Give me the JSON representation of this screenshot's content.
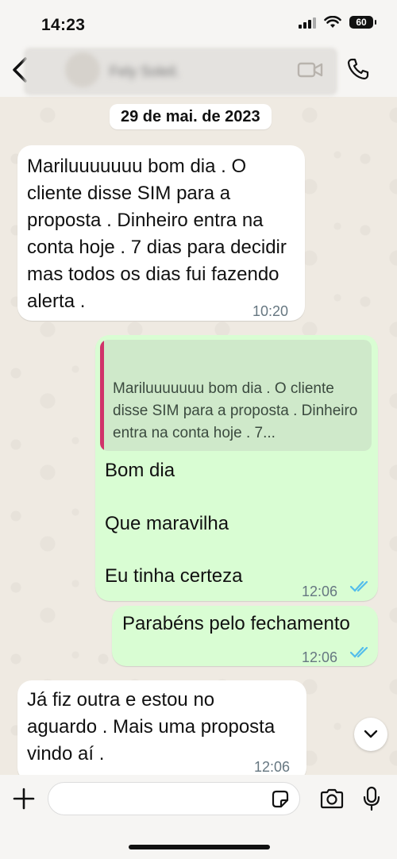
{
  "status_bar": {
    "time": "14:23",
    "battery": "60"
  },
  "header": {
    "contact_name": "Fely Soleil."
  },
  "date_chip": "29 de mai. de 2023",
  "messages": [
    {
      "dir": "in",
      "text": "Mariluuuuuuu bom dia . O cliente disse SIM para a proposta . Dinheiro entra na conta hoje . 7 dias para decidir mas todos os dias fui fazendo alerta .",
      "time": "10:20"
    },
    {
      "dir": "out",
      "quote": "Mariluuuuuuu bom dia . O cliente disse SIM para a proposta . Dinheiro entra na conta hoje . 7...",
      "lines": [
        "Bom dia",
        "Que maravilha",
        "Eu tinha certeza"
      ],
      "time": "12:06"
    },
    {
      "dir": "out",
      "text": "Parabéns pelo fechamento",
      "time": "12:06"
    },
    {
      "dir": "in",
      "text": "Já fiz outra e estou no aguardo .  Mais uma proposta vindo aí .",
      "time": "12:06"
    }
  ],
  "composer": {
    "placeholder": ""
  },
  "colors": {
    "incoming": "#ffffff",
    "outgoing": "#d9fdd3",
    "ticks": "#53bdeb",
    "quote_bar": "#d0336a"
  },
  "icons": [
    "back-arrow-icon",
    "video-call-icon",
    "phone-icon",
    "chevron-down-icon",
    "plus-icon",
    "sticker-icon",
    "camera-icon",
    "mic-icon"
  ]
}
